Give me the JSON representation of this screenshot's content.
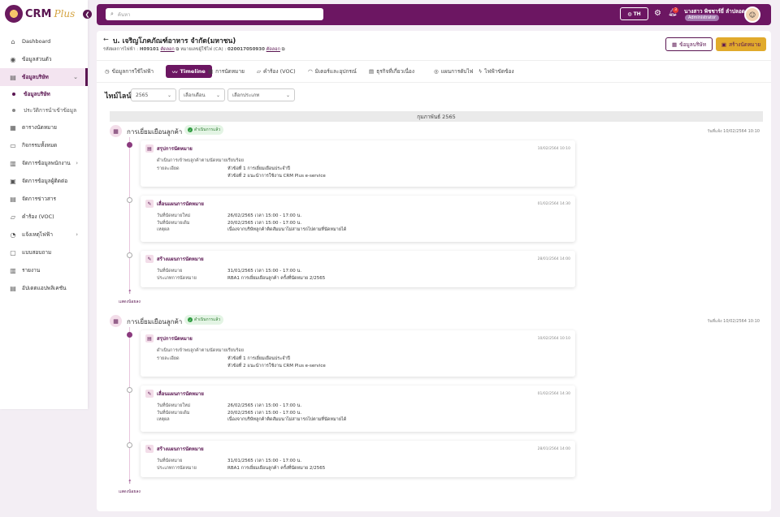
{
  "app": {
    "logo_text": "CRM",
    "logo_plus": "Plus"
  },
  "sidebar": {
    "items": [
      {
        "label": "Dashboard",
        "icon": "home-icon"
      },
      {
        "label": "ข้อมูลส่วนตัว",
        "icon": "person-icon"
      },
      {
        "label": "ข้อมูลบริษัท",
        "icon": "company-icon",
        "active": true
      },
      {
        "label": "ข้อมูลบริษัท",
        "sub": true,
        "active": true
      },
      {
        "label": "ประวัติการนำเข้าข้อมูล",
        "sub": true
      },
      {
        "label": "ตารางนัดหมาย",
        "icon": "calendar-icon"
      },
      {
        "label": "กิจกรรมทั้งหมด",
        "icon": "activity-icon"
      },
      {
        "label": "จัดการข้อมูลพนักงาน",
        "icon": "staff-icon",
        "arrow": true
      },
      {
        "label": "จัดการข้อมูลผู้ติดต่อ",
        "icon": "contact-icon"
      },
      {
        "label": "จัดการข่าวสาร",
        "icon": "news-icon"
      },
      {
        "label": "คำร้อง (VOC)",
        "icon": "voc-icon"
      },
      {
        "label": "แจ้งเหตุไฟฟ้า",
        "icon": "power-icon",
        "arrow": true
      },
      {
        "label": "แบบสอบถาม",
        "icon": "survey-icon"
      },
      {
        "label": "รายงาน",
        "icon": "report-icon"
      },
      {
        "label": "อัปเดตแอปพลิเคชัน",
        "icon": "update-icon"
      }
    ]
  },
  "topbar": {
    "search_placeholder": "ค้นหา",
    "lang": "TH",
    "notif_count": "3",
    "user_name": "นางสาว พิชชาร์ยี่ ลำปลอด",
    "user_role": "Administrator"
  },
  "header": {
    "company": "บ. เจริญโภคภัณฑ์อาหาร จำกัด(มหาชน)",
    "cust_label": "รหัสผลการไฟฟ้า :",
    "cust_id": "H09101",
    "copy1": "คัดลอก",
    "ca_label": "หมายเลขผู้ใช้ไฟ (CA) :",
    "ca_id": "020017050930",
    "copy2": "คัดลอก",
    "btn_company": "ข้อมูลบริษัท",
    "btn_create": "สร้างนัดหมาย"
  },
  "tabs": [
    {
      "label": "ข้อมูลการใช้ไฟฟ้า",
      "icon": "clock-icon"
    },
    {
      "label": "Timeline",
      "icon": "timeline-icon",
      "active": true
    },
    {
      "label": "การนัดหมาย",
      "icon": "calendar-icon"
    },
    {
      "label": "คำร้อง (VOC)",
      "icon": "voc-icon"
    },
    {
      "label": "มิเตอร์และอุปกรณ์",
      "icon": "meter-icon"
    },
    {
      "label": "ธุรกิจที่เกี่ยวเนื่อง",
      "icon": "business-icon"
    },
    {
      "label": "แผนการดับไฟ",
      "icon": "bulb-icon"
    },
    {
      "label": "ไฟฟ้าขัดข้อง",
      "icon": "bolt-icon"
    }
  ],
  "filters": {
    "label": "ไทม์ไลน์",
    "year": "2565",
    "month": "เลือกเดือน",
    "type": "เลือกประเภท"
  },
  "month_header": "กุมภาพันธ์ 2565",
  "visits": [
    {
      "title": "การเยี่ยมเยือนลูกค้า",
      "status": "ดำเนินการแล้ว",
      "date": "วันที่แจ้ง 10/02/2564 10:10",
      "more": "แสดงน้อยลง",
      "cards": [
        {
          "title": "สรุปการนัดหมาย",
          "date": "10/02/2564 10:10",
          "desc": "ดำเนินการเข้าพบลูกค้าตามนัดหมายเรียบร้อย",
          "rows": [
            {
              "k": "รายละเอียด",
              "v": "หัวข้อที่ 1 การเยี่ยมเยือนประจำปี"
            },
            {
              "k": "",
              "v": "หัวข้อที่ 2 แนะนำการใช้งาน CRM Plus e-service"
            }
          ]
        },
        {
          "title": "เลื่อนแผนการนัดหมาย",
          "date": "01/02/2564 14:30",
          "desc": "",
          "rows": [
            {
              "k": "วันที่นัดหมายใหม่",
              "v": "26/02/2565 เวลา 15:00 - 17:00 น."
            },
            {
              "k": "วันที่นัดหมายเดิม",
              "v": "20/02/2565 เวลา 15:00 - 17:00 น."
            },
            {
              "k": "เหตุผล",
              "v": "เนื่องจากบริษัทลูกค้าติดสัมมนาไม่สามารถไปตามที่นัดหมายได้"
            }
          ]
        },
        {
          "title": "สร้างแผนการนัดหมาย",
          "date": "28/01/2564 14:00",
          "desc": "",
          "rows": [
            {
              "k": "วันที่นัดหมาย",
              "v": "31/01/2565 เวลา 15:00 - 17:00 น."
            },
            {
              "k": "ประเภทการนัดหมาย",
              "v": "RBA1 การเยี่ยมเยือนลูกค้า ครั้งที่นัดหมาย 2/2565"
            }
          ]
        }
      ]
    },
    {
      "title": "การเยี่ยมเยือนลูกค้า",
      "status": "ดำเนินการแล้ว",
      "date": "วันที่แจ้ง 10/02/2564 10:10",
      "more": "แสดงน้อยลง",
      "cards": [
        {
          "title": "สรุปการนัดหมาย",
          "date": "10/02/2564 10:10",
          "desc": "ดำเนินการเข้าพบลูกค้าตามนัดหมายเรียบร้อย",
          "rows": [
            {
              "k": "รายละเอียด",
              "v": "หัวข้อที่ 1 การเยี่ยมเยือนประจำปี"
            },
            {
              "k": "",
              "v": "หัวข้อที่ 2 แนะนำการใช้งาน CRM Plus e-service"
            }
          ]
        },
        {
          "title": "เลื่อนแผนการนัดหมาย",
          "date": "01/02/2564 14:30",
          "desc": "",
          "rows": [
            {
              "k": "วันที่นัดหมายใหม่",
              "v": "26/02/2565 เวลา 15:00 - 17:00 น."
            },
            {
              "k": "วันที่นัดหมายเดิม",
              "v": "20/02/2565 เวลา 15:00 - 17:00 น."
            },
            {
              "k": "เหตุผล",
              "v": "เนื่องจากบริษัทลูกค้าติดสัมมนาไม่สามารถไปตามที่นัดหมายได้"
            }
          ]
        },
        {
          "title": "สร้างแผนการนัดหมาย",
          "date": "28/01/2564 14:00",
          "desc": "",
          "rows": [
            {
              "k": "วันที่นัดหมาย",
              "v": "31/01/2565 เวลา 15:00 - 17:00 น."
            },
            {
              "k": "ประเภทการนัดหมาย",
              "v": "RBA1 การเยี่ยมเยือนลูกค้า ครั้งที่นัดหมาย 2/2565"
            }
          ]
        }
      ]
    }
  ]
}
